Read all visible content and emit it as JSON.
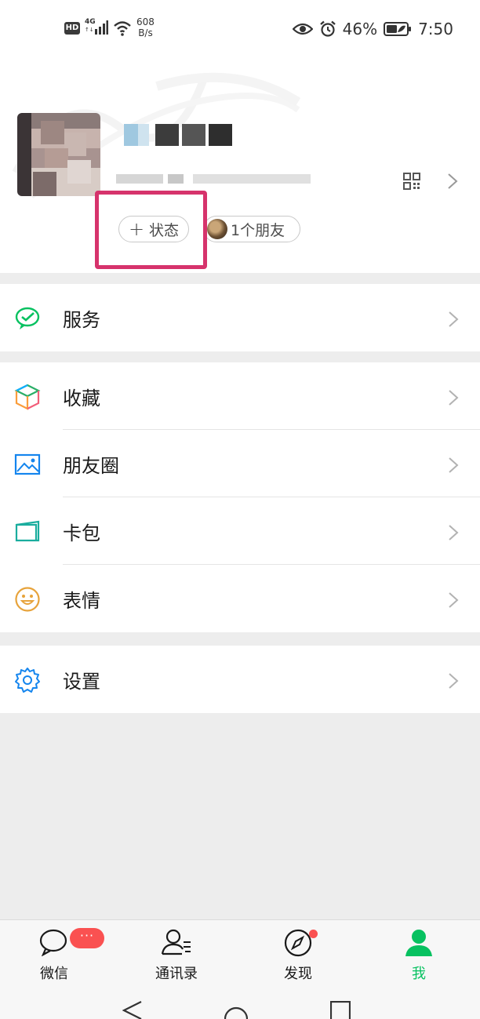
{
  "status_bar": {
    "hd": "HD",
    "network": "4G",
    "network_sub": "↑↓",
    "speed_value": "608",
    "speed_unit": "B/s",
    "battery_percent": "46%",
    "time": "7:50"
  },
  "profile": {
    "status_button_icon": "+",
    "status_button_label": "状态",
    "friends_button_label": "1个朋友"
  },
  "menu": {
    "group1": [
      {
        "label": "服务",
        "icon": "wechat-pay-icon"
      }
    ],
    "group2": [
      {
        "label": "收藏",
        "icon": "favorites-cube-icon"
      },
      {
        "label": "朋友圈",
        "icon": "moments-picture-icon"
      },
      {
        "label": "卡包",
        "icon": "card-wallet-icon"
      },
      {
        "label": "表情",
        "icon": "smiley-icon"
      }
    ],
    "group3": [
      {
        "label": "设置",
        "icon": "settings-gear-icon"
      }
    ]
  },
  "tabs": [
    {
      "label": "微信",
      "icon": "chat-bubble-icon",
      "badge": "···"
    },
    {
      "label": "通讯录",
      "icon": "contacts-icon"
    },
    {
      "label": "发现",
      "icon": "compass-icon"
    },
    {
      "label": "我",
      "icon": "person-icon",
      "active": true
    }
  ],
  "colors": {
    "accent_green": "#07c160",
    "badge_red": "#fa5151",
    "highlight": "#d6336c"
  }
}
